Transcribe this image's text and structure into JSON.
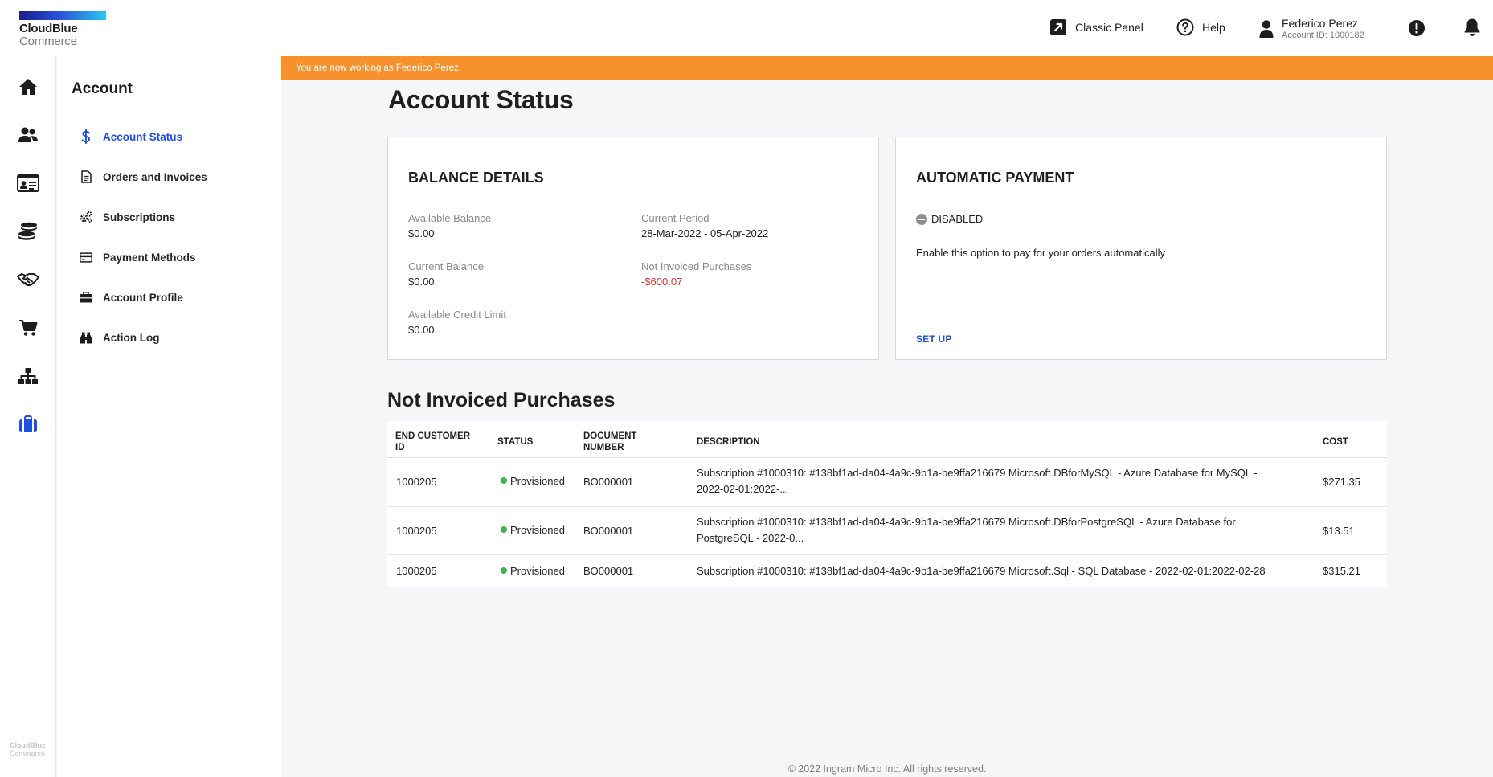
{
  "header": {
    "logo_line1": "CloudBlue",
    "logo_line2": "Commerce",
    "classic_panel": "Classic Panel",
    "help": "Help",
    "user_name": "Federico Perez",
    "account_id": "Account ID: 1000182"
  },
  "rail": {
    "items": [
      "home-icon",
      "users-icon",
      "contact-card-icon",
      "coins-icon",
      "handshake-icon",
      "cart-icon",
      "sitemap-icon",
      "briefcase-icon"
    ],
    "footer_line1": "CloudBlue",
    "footer_line2": "Commerce"
  },
  "subnav": {
    "title": "Account",
    "items": [
      {
        "label": "Account Status",
        "icon": "dollar-icon"
      },
      {
        "label": "Orders and Invoices",
        "icon": "document-icon"
      },
      {
        "label": "Subscriptions",
        "icon": "gears-icon"
      },
      {
        "label": "Payment Methods",
        "icon": "credit-card-icon"
      },
      {
        "label": "Account Profile",
        "icon": "briefcase-icon"
      },
      {
        "label": "Action Log",
        "icon": "binoculars-icon"
      }
    ]
  },
  "banner": "You are now working as Federico Perez.",
  "page_title": "Account Status",
  "balance": {
    "title": "BALANCE DETAILS",
    "available_balance_label": "Available Balance",
    "available_balance": "$0.00",
    "current_balance_label": "Current Balance",
    "current_balance": "$0.00",
    "credit_limit_label": "Available Credit Limit",
    "credit_limit": "$0.00",
    "current_period_label": "Current Period",
    "current_period": "28-Mar-2022 - 05-Apr-2022",
    "not_invoiced_label": "Not Invoiced Purchases",
    "not_invoiced": "-$600.07"
  },
  "autopay": {
    "title": "AUTOMATIC PAYMENT",
    "status": "DISABLED",
    "description": "Enable this option to pay for your orders automatically",
    "setup": "SET UP"
  },
  "purchases": {
    "title": "Not Invoiced Purchases",
    "columns": {
      "customer_1": "END CUSTOMER",
      "customer_2": "ID",
      "status": "STATUS",
      "doc_1": "DOCUMENT",
      "doc_2": "NUMBER",
      "description": "DESCRIPTION",
      "cost": "COST"
    },
    "rows": [
      {
        "customer": "1000205",
        "status": "Provisioned",
        "document": "BO000001",
        "desc_line1": "Subscription #1000310: #138bf1ad-da04-4a9c-9b1a-be9ffa216679 Microsoft.DBforMySQL - Azure Database for MySQL -",
        "desc_line2": "2022-02-01:2022-...",
        "cost": "$271.35"
      },
      {
        "customer": "1000205",
        "status": "Provisioned",
        "document": "BO000001",
        "desc_line1": "Subscription #1000310: #138bf1ad-da04-4a9c-9b1a-be9ffa216679 Microsoft.DBforPostgreSQL - Azure Database for",
        "desc_line2": "PostgreSQL - 2022-0...",
        "cost": "$13.51"
      },
      {
        "customer": "1000205",
        "status": "Provisioned",
        "document": "BO000001",
        "desc_line1": "Subscription #1000310: #138bf1ad-da04-4a9c-9b1a-be9ffa216679 Microsoft.Sql - SQL Database - 2022-02-01:2022-02-28",
        "desc_line2": "",
        "cost": "$315.21"
      }
    ]
  },
  "footer": "© 2022 Ingram Micro Inc. All rights reserved.",
  "colors": {
    "accent": "#1e4fe0",
    "banner": "#f7912e",
    "negative": "#d5322d",
    "provisioned": "#3fb34f"
  }
}
